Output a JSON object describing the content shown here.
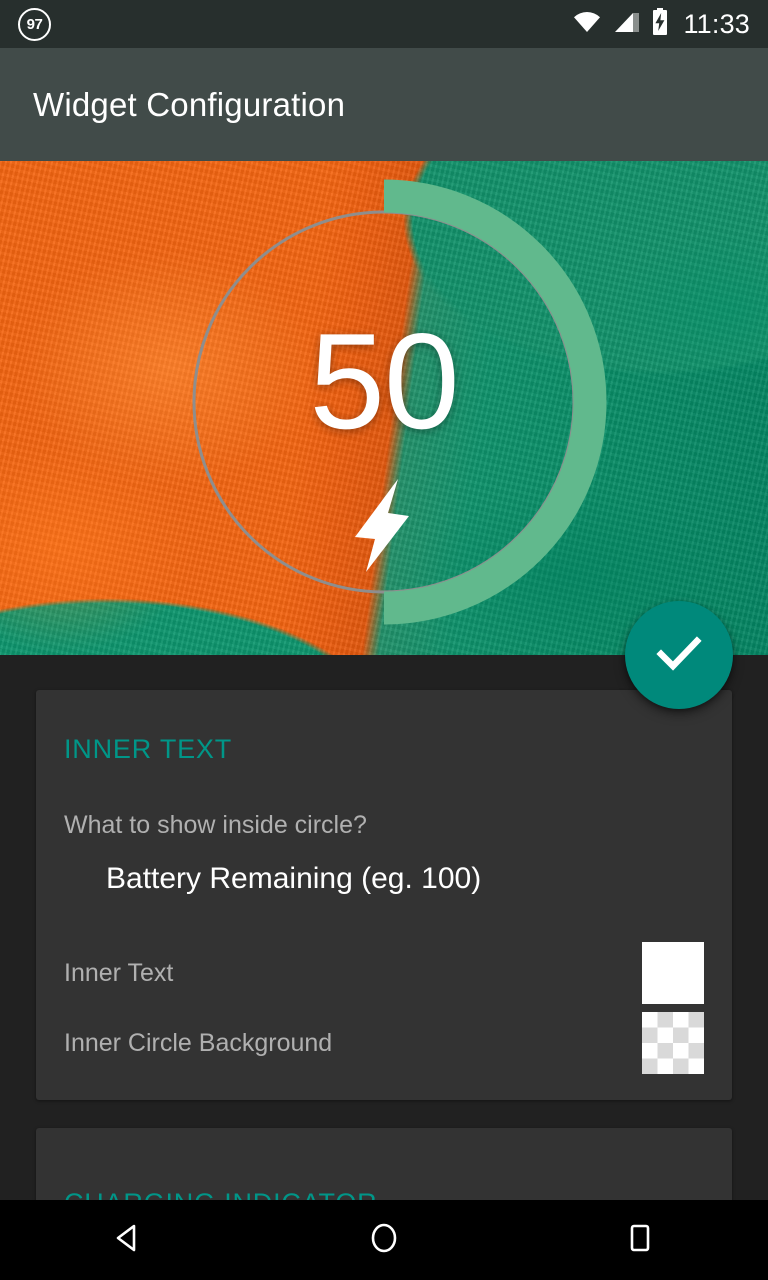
{
  "status_bar": {
    "notification_badge": "97",
    "icons": [
      "wifi-icon",
      "signal-icon",
      "battery-charging-icon"
    ],
    "time": "11:33",
    "background_color": "#272f2d"
  },
  "app_bar": {
    "title": "Widget Configuration",
    "background_color": "#414b49",
    "title_color": "#ffffff"
  },
  "preview": {
    "gauge_value": "50",
    "gauge_progress_percent": 50,
    "progress_color": "#61b98d",
    "track_color": "#8e8e8e",
    "charging_icon": "lightning-bolt-icon",
    "value_color": "#ffffff"
  },
  "fab": {
    "icon": "check-icon",
    "color": "#00897b",
    "icon_color": "#ffffff"
  },
  "cards": [
    {
      "header": "INNER TEXT",
      "question_label": "What to show inside circle?",
      "question_value": "Battery Remaining (eg. 100)",
      "rows": [
        {
          "label": "Inner Text",
          "swatch": "solid",
          "swatch_color": "#ffffff"
        },
        {
          "label": "Inner Circle Background",
          "swatch": "checker",
          "swatch_color": "transparent"
        }
      ]
    },
    {
      "header": "CHARGING INDICATOR"
    }
  ],
  "nav_bar": {
    "back": "back-triangle-icon",
    "home": "home-circle-icon",
    "recents": "recents-square-icon",
    "background_color": "#000000"
  },
  "accent_color": "#009688"
}
